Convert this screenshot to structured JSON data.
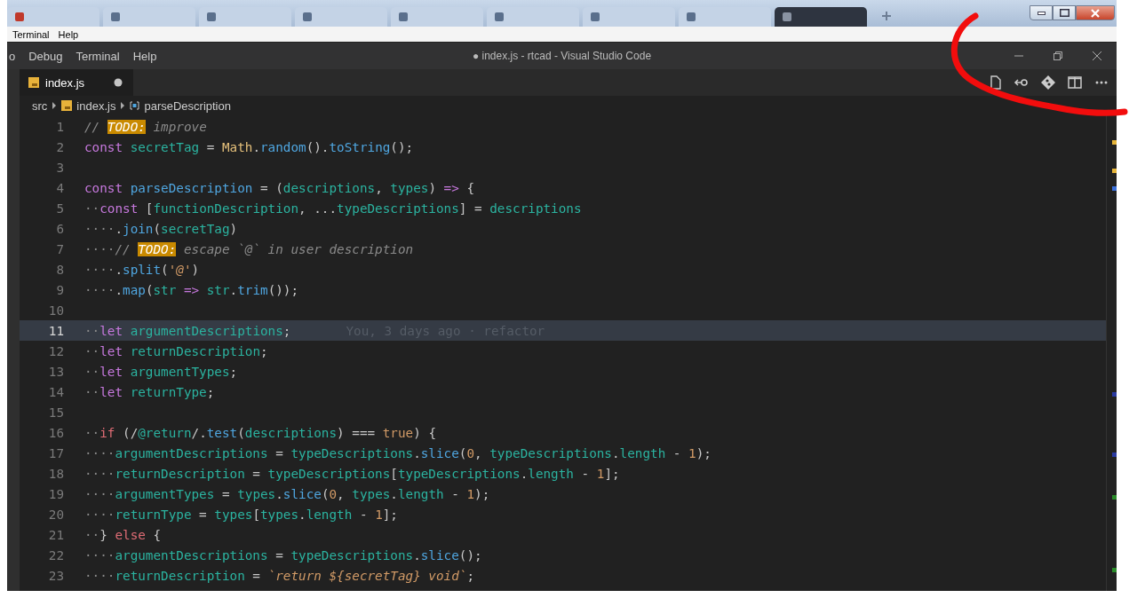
{
  "browser_tabs": [
    {
      "selected": false
    },
    {
      "selected": false
    },
    {
      "selected": false
    },
    {
      "selected": false
    },
    {
      "selected": false
    },
    {
      "selected": false
    },
    {
      "selected": false
    },
    {
      "selected": false
    },
    {
      "selected": true
    }
  ],
  "outer_menu": [
    "Terminal",
    "Help"
  ],
  "vscode": {
    "menu": [
      "o",
      "Debug",
      "Terminal",
      "Help"
    ],
    "title": "● index.js - rtcad - Visual Studio Code",
    "tabs": [
      {
        "label": "index.js",
        "modified": true,
        "selected": true
      }
    ],
    "breadcrumb": [
      "src",
      "index.js",
      "parseDescription"
    ],
    "lines": [
      {
        "number": "1",
        "selected": false,
        "tokens": [
          {
            "kind": "comment",
            "text": "// "
          },
          {
            "kind": "todo",
            "text": "TODO:"
          },
          {
            "kind": "comment",
            "text": " improve"
          }
        ]
      },
      {
        "number": "2",
        "selected": false,
        "tokens": [
          {
            "kind": "keyword",
            "text": "const "
          },
          {
            "kind": "variable",
            "text": "secretTag"
          },
          {
            "kind": "punct",
            "text": " = "
          },
          {
            "kind": "object",
            "text": "Math"
          },
          {
            "kind": "punct",
            "text": "."
          },
          {
            "kind": "function",
            "text": "random"
          },
          {
            "kind": "punct",
            "text": "()."
          },
          {
            "kind": "function",
            "text": "toString"
          },
          {
            "kind": "punct",
            "text": "();"
          }
        ]
      },
      {
        "number": "3",
        "selected": false
      },
      {
        "number": "4",
        "selected": false,
        "tokens": [
          {
            "kind": "keyword",
            "text": "const "
          },
          {
            "kind": "function",
            "text": "parseDescription"
          },
          {
            "kind": "punct",
            "text": " = ("
          },
          {
            "kind": "variable",
            "text": "descriptions"
          },
          {
            "kind": "punct",
            "text": ", "
          },
          {
            "kind": "variable",
            "text": "types"
          },
          {
            "kind": "punct",
            "text": ") "
          },
          {
            "kind": "keyword",
            "text": "=>"
          },
          {
            "kind": "punct",
            "text": " {"
          }
        ]
      },
      {
        "number": "5",
        "selected": false,
        "tokens": [
          {
            "kind": "whitespace",
            "text": "··"
          },
          {
            "kind": "keyword",
            "text": "const"
          },
          {
            "kind": "punct",
            "text": " ["
          },
          {
            "kind": "variable",
            "text": "functionDescription"
          },
          {
            "kind": "punct",
            "text": ", ..."
          },
          {
            "kind": "variable",
            "text": "typeDescriptions"
          },
          {
            "kind": "punct",
            "text": "] = "
          },
          {
            "kind": "variable",
            "text": "descriptions"
          }
        ]
      },
      {
        "number": "6",
        "selected": false,
        "tokens": [
          {
            "kind": "whitespace",
            "text": "····"
          },
          {
            "kind": "punct",
            "text": "."
          },
          {
            "kind": "function",
            "text": "join"
          },
          {
            "kind": "punct",
            "text": "("
          },
          {
            "kind": "variable",
            "text": "secretTag"
          },
          {
            "kind": "punct",
            "text": ")"
          }
        ]
      },
      {
        "number": "7",
        "selected": false,
        "tokens": [
          {
            "kind": "whitespace",
            "text": "····"
          },
          {
            "kind": "comment",
            "text": "// "
          },
          {
            "kind": "todo",
            "text": "TODO:"
          },
          {
            "kind": "comment",
            "text": " escape `@` in user description"
          }
        ]
      },
      {
        "number": "8",
        "selected": false,
        "tokens": [
          {
            "kind": "whitespace",
            "text": "····"
          },
          {
            "kind": "punct",
            "text": "."
          },
          {
            "kind": "function",
            "text": "split"
          },
          {
            "kind": "punct",
            "text": "("
          },
          {
            "kind": "string",
            "text": "'@'"
          },
          {
            "kind": "punct",
            "text": ")"
          }
        ]
      },
      {
        "number": "9",
        "selected": false,
        "tokens": [
          {
            "kind": "whitespace",
            "text": "····"
          },
          {
            "kind": "punct",
            "text": "."
          },
          {
            "kind": "function",
            "text": "map"
          },
          {
            "kind": "punct",
            "text": "("
          },
          {
            "kind": "variable",
            "text": "str "
          },
          {
            "kind": "keyword",
            "text": "=> "
          },
          {
            "kind": "variable",
            "text": "str"
          },
          {
            "kind": "punct",
            "text": "."
          },
          {
            "kind": "function",
            "text": "trim"
          },
          {
            "kind": "punct",
            "text": "());"
          }
        ]
      },
      {
        "number": "10",
        "selected": false
      },
      {
        "number": "11",
        "selected": true,
        "tokens": [
          {
            "kind": "whitespace",
            "text": "··"
          },
          {
            "kind": "keyword",
            "text": "let "
          },
          {
            "kind": "variable",
            "text": "argumentDescriptions"
          },
          {
            "kind": "punct",
            "text": ";"
          }
        ],
        "blame": "You, 3 days ago · refactor"
      },
      {
        "number": "12",
        "selected": false,
        "tokens": [
          {
            "kind": "whitespace",
            "text": "··"
          },
          {
            "kind": "keyword",
            "text": "let "
          },
          {
            "kind": "variable",
            "text": "returnDescription"
          },
          {
            "kind": "punct",
            "text": ";"
          }
        ]
      },
      {
        "number": "13",
        "selected": false,
        "tokens": [
          {
            "kind": "whitespace",
            "text": "··"
          },
          {
            "kind": "keyword",
            "text": "let "
          },
          {
            "kind": "variable",
            "text": "argumentTypes"
          },
          {
            "kind": "punct",
            "text": ";"
          }
        ]
      },
      {
        "number": "14",
        "selected": false,
        "tokens": [
          {
            "kind": "whitespace",
            "text": "··"
          },
          {
            "kind": "keyword",
            "text": "let "
          },
          {
            "kind": "variable",
            "text": "returnType"
          },
          {
            "kind": "punct",
            "text": ";"
          }
        ]
      },
      {
        "number": "15",
        "selected": false
      },
      {
        "number": "16",
        "selected": false,
        "tokens": [
          {
            "kind": "whitespace",
            "text": "··"
          },
          {
            "kind": "control",
            "text": "if"
          },
          {
            "kind": "punct",
            "text": " (/"
          },
          {
            "kind": "variable",
            "text": "@return"
          },
          {
            "kind": "punct",
            "text": "/."
          },
          {
            "kind": "function",
            "text": "test"
          },
          {
            "kind": "punct",
            "text": "("
          },
          {
            "kind": "variable",
            "text": "descriptions"
          },
          {
            "kind": "punct",
            "text": ") === "
          },
          {
            "kind": "boolean",
            "text": "true"
          },
          {
            "kind": "punct",
            "text": ") {"
          }
        ]
      },
      {
        "number": "17",
        "selected": false,
        "tokens": [
          {
            "kind": "whitespace",
            "text": "····"
          },
          {
            "kind": "variable",
            "text": "argumentDescriptions"
          },
          {
            "kind": "punct",
            "text": " = "
          },
          {
            "kind": "variable",
            "text": "typeDescriptions"
          },
          {
            "kind": "punct",
            "text": "."
          },
          {
            "kind": "function",
            "text": "slice"
          },
          {
            "kind": "punct",
            "text": "("
          },
          {
            "kind": "number",
            "text": "0"
          },
          {
            "kind": "punct",
            "text": ", "
          },
          {
            "kind": "variable",
            "text": "typeDescriptions"
          },
          {
            "kind": "punct",
            "text": "."
          },
          {
            "kind": "variable",
            "text": "length"
          },
          {
            "kind": "punct",
            "text": " - "
          },
          {
            "kind": "number",
            "text": "1"
          },
          {
            "kind": "punct",
            "text": ");"
          }
        ]
      },
      {
        "number": "18",
        "selected": false,
        "tokens": [
          {
            "kind": "whitespace",
            "text": "····"
          },
          {
            "kind": "variable",
            "text": "returnDescription"
          },
          {
            "kind": "punct",
            "text": " = "
          },
          {
            "kind": "variable",
            "text": "typeDescriptions"
          },
          {
            "kind": "punct",
            "text": "["
          },
          {
            "kind": "variable",
            "text": "typeDescriptions"
          },
          {
            "kind": "punct",
            "text": "."
          },
          {
            "kind": "variable",
            "text": "length"
          },
          {
            "kind": "punct",
            "text": " - "
          },
          {
            "kind": "number",
            "text": "1"
          },
          {
            "kind": "punct",
            "text": "];"
          }
        ]
      },
      {
        "number": "19",
        "selected": false,
        "tokens": [
          {
            "kind": "whitespace",
            "text": "····"
          },
          {
            "kind": "variable",
            "text": "argumentTypes"
          },
          {
            "kind": "punct",
            "text": " = "
          },
          {
            "kind": "variable",
            "text": "types"
          },
          {
            "kind": "punct",
            "text": "."
          },
          {
            "kind": "function",
            "text": "slice"
          },
          {
            "kind": "punct",
            "text": "("
          },
          {
            "kind": "number",
            "text": "0"
          },
          {
            "kind": "punct",
            "text": ", "
          },
          {
            "kind": "variable",
            "text": "types"
          },
          {
            "kind": "punct",
            "text": "."
          },
          {
            "kind": "variable",
            "text": "length"
          },
          {
            "kind": "punct",
            "text": " - "
          },
          {
            "kind": "number",
            "text": "1"
          },
          {
            "kind": "punct",
            "text": ");"
          }
        ]
      },
      {
        "number": "20",
        "selected": false,
        "tokens": [
          {
            "kind": "whitespace",
            "text": "····"
          },
          {
            "kind": "variable",
            "text": "returnType"
          },
          {
            "kind": "punct",
            "text": " = "
          },
          {
            "kind": "variable",
            "text": "types"
          },
          {
            "kind": "punct",
            "text": "["
          },
          {
            "kind": "variable",
            "text": "types"
          },
          {
            "kind": "punct",
            "text": "."
          },
          {
            "kind": "variable",
            "text": "length"
          },
          {
            "kind": "punct",
            "text": " - "
          },
          {
            "kind": "number",
            "text": "1"
          },
          {
            "kind": "punct",
            "text": "];"
          }
        ]
      },
      {
        "number": "21",
        "selected": false,
        "tokens": [
          {
            "kind": "whitespace",
            "text": "··"
          },
          {
            "kind": "punct",
            "text": "} "
          },
          {
            "kind": "control",
            "text": "else"
          },
          {
            "kind": "punct",
            "text": " {"
          }
        ]
      },
      {
        "number": "22",
        "selected": false,
        "tokens": [
          {
            "kind": "whitespace",
            "text": "····"
          },
          {
            "kind": "variable",
            "text": "argumentDescriptions"
          },
          {
            "kind": "punct",
            "text": " = "
          },
          {
            "kind": "variable",
            "text": "typeDescriptions"
          },
          {
            "kind": "punct",
            "text": "."
          },
          {
            "kind": "function",
            "text": "slice"
          },
          {
            "kind": "punct",
            "text": "();"
          }
        ]
      },
      {
        "number": "23",
        "selected": false,
        "tokens": [
          {
            "kind": "whitespace",
            "text": "····"
          },
          {
            "kind": "variable",
            "text": "returnDescription"
          },
          {
            "kind": "punct",
            "text": " = "
          },
          {
            "kind": "string",
            "text": "`return ${secretTag} void`"
          },
          {
            "kind": "punct",
            "text": ";"
          }
        ]
      }
    ]
  }
}
